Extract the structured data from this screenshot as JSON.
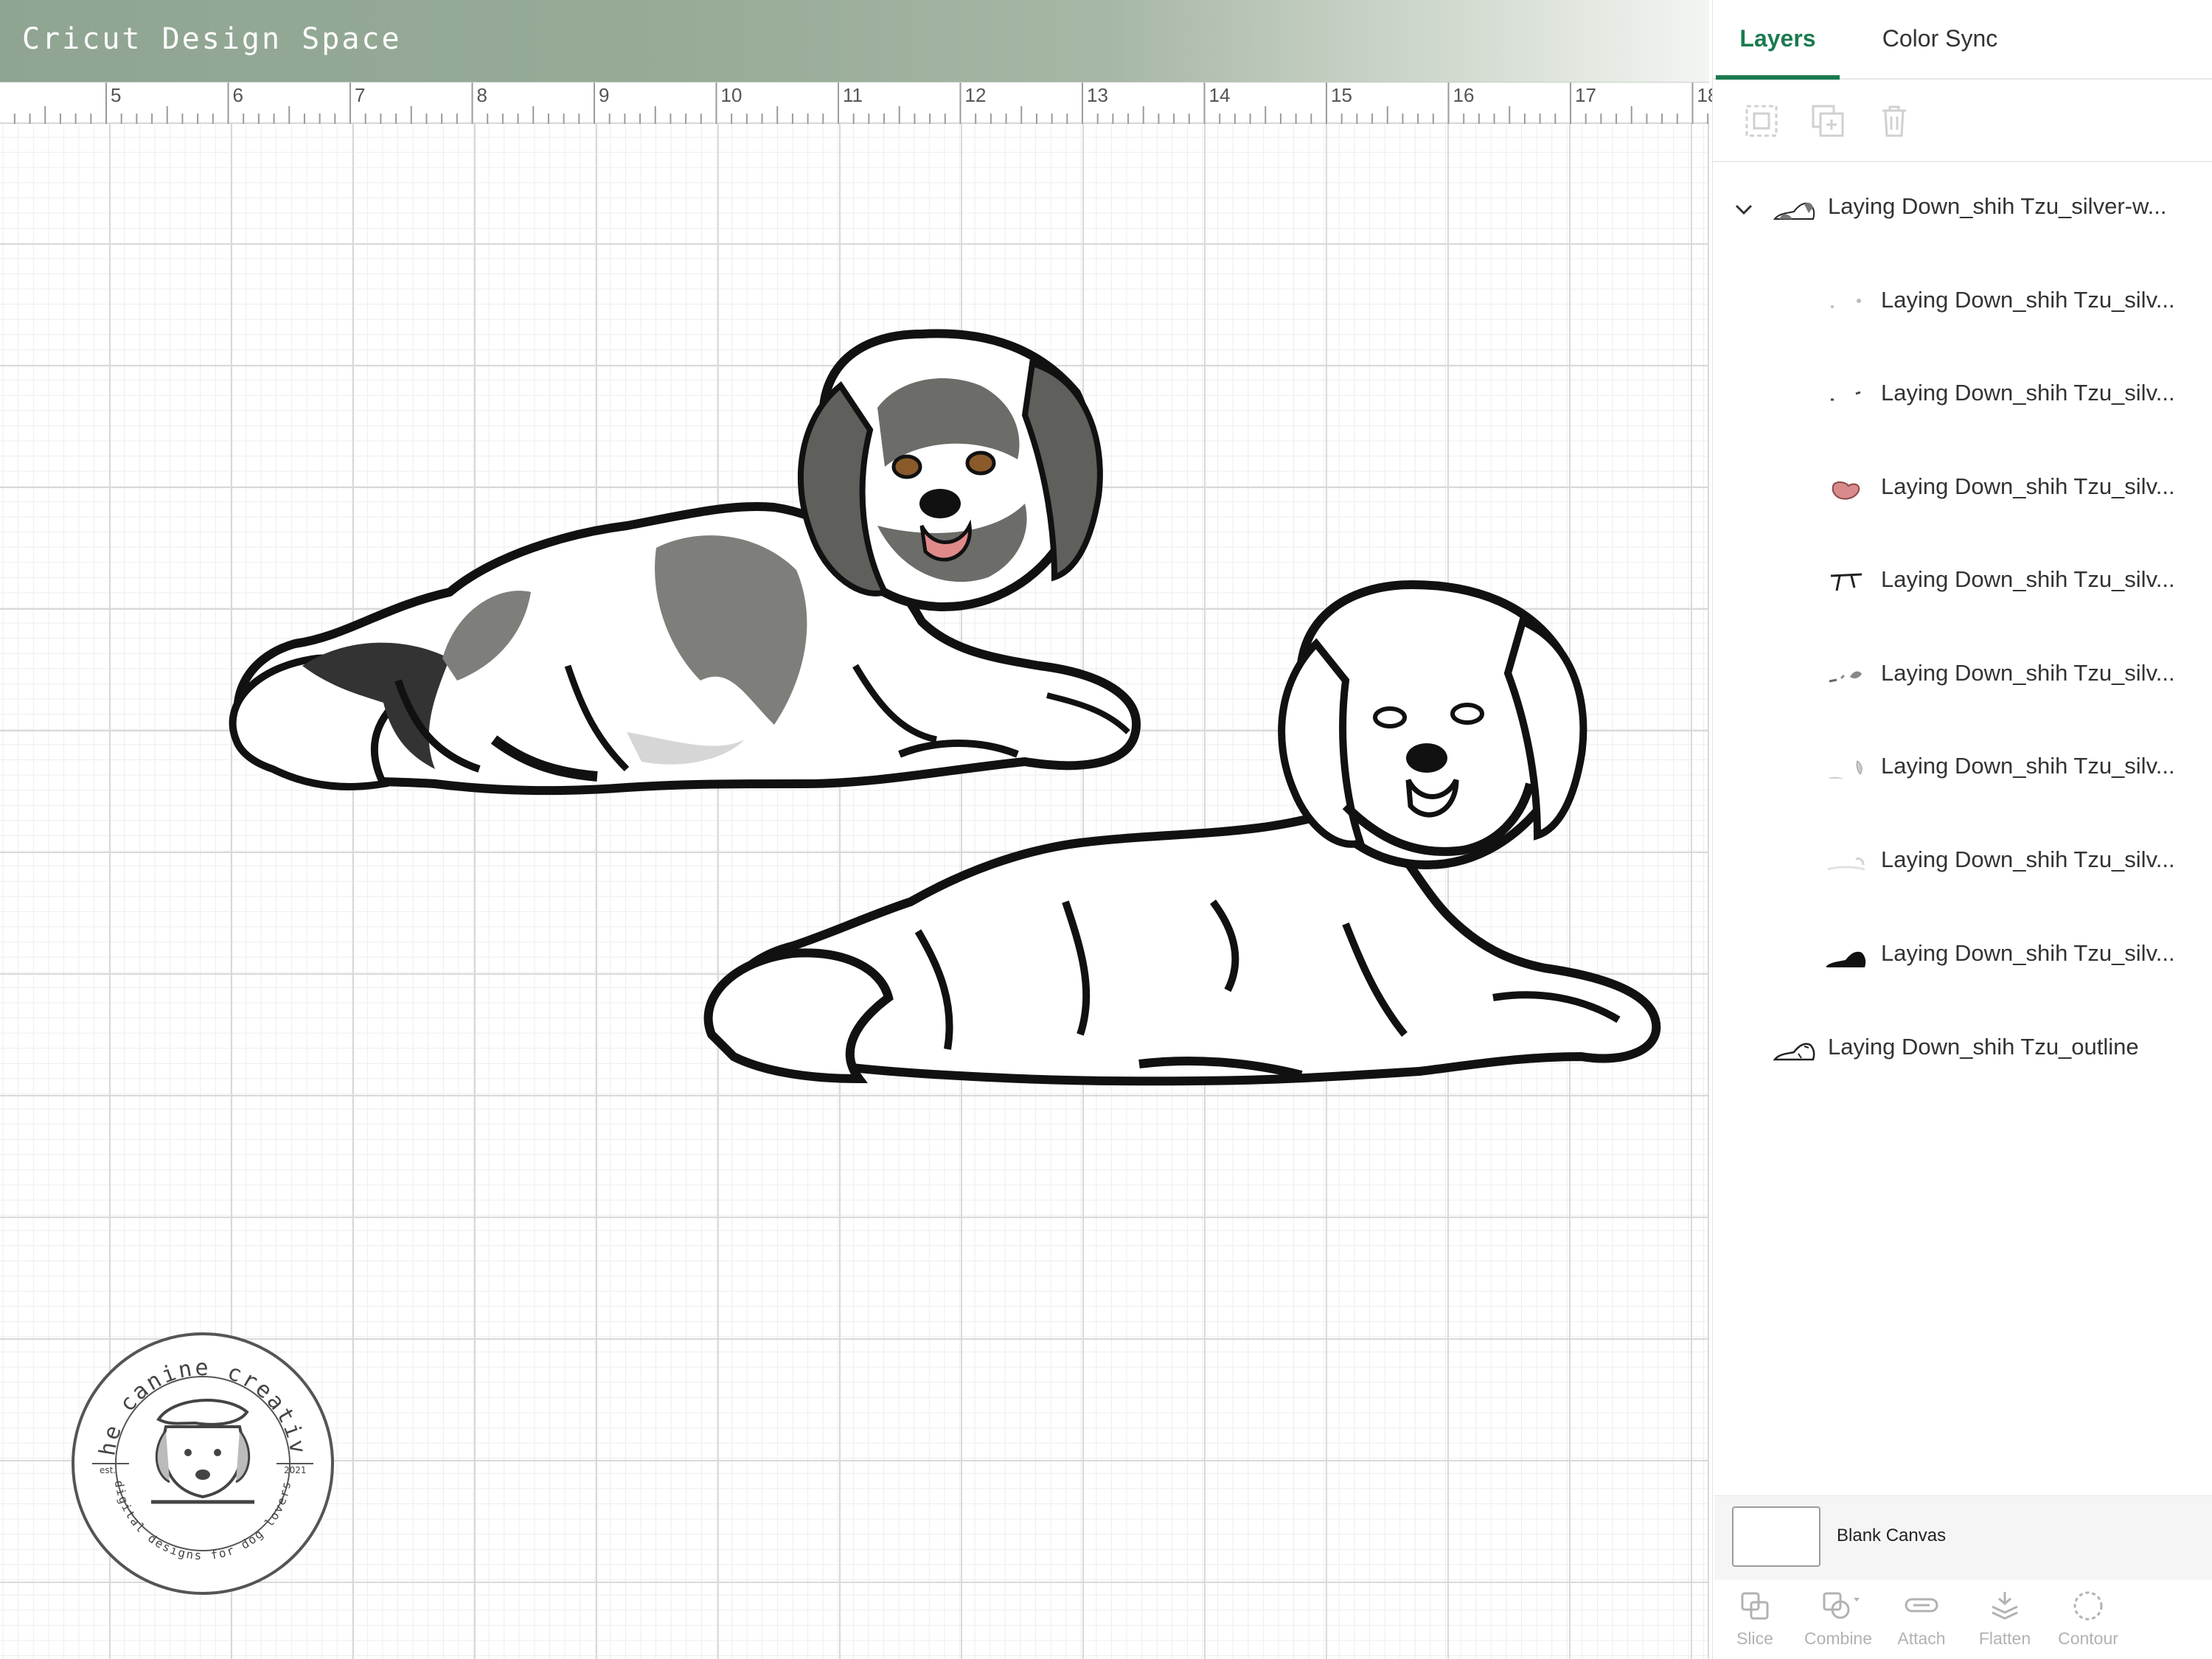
{
  "app": {
    "title": "Cricut Design Space"
  },
  "ruler": {
    "labels": [
      "5",
      "6",
      "7",
      "8",
      "9",
      "10",
      "11",
      "12",
      "13",
      "14",
      "15",
      "16",
      "17",
      "18"
    ]
  },
  "panel": {
    "tabs": [
      {
        "label": "Layers",
        "active": true
      },
      {
        "label": "Color Sync",
        "active": false
      }
    ],
    "toolbar": [
      "group-icon",
      "duplicate-icon",
      "delete-icon"
    ],
    "layers": [
      {
        "label": "Laying Down_shih Tzu_silver-w...",
        "level": 0,
        "expanded": true,
        "thumb": "dog-thumb"
      },
      {
        "label": "Laying Down_shih Tzu_silv...",
        "level": 1,
        "thumb": "speck-thumb"
      },
      {
        "label": "Laying Down_shih Tzu_silv...",
        "level": 1,
        "thumb": "dash-thumb"
      },
      {
        "label": "Laying Down_shih Tzu_silv...",
        "level": 1,
        "thumb": "tongue-thumb",
        "color": "#d98a8a"
      },
      {
        "label": "Laying Down_shih Tzu_silv...",
        "level": 1,
        "thumb": "eyes-thumb"
      },
      {
        "label": "Laying Down_shih Tzu_silv...",
        "level": 1,
        "thumb": "grey-patch-thumb"
      },
      {
        "label": "Laying Down_shih Tzu_silv...",
        "level": 1,
        "thumb": "light-patch-thumb"
      },
      {
        "label": "Laying Down_shih Tzu_silv...",
        "level": 1,
        "thumb": "faint-patch-thumb"
      },
      {
        "label": "Laying Down_shih Tzu_silv...",
        "level": 1,
        "thumb": "black-silhouette-thumb"
      },
      {
        "label": "Laying Down_shih Tzu_outline",
        "level": 0,
        "thumb": "outline-thumb"
      }
    ],
    "canvas": {
      "label": "Blank Canvas"
    },
    "actions": [
      {
        "label": "Slice",
        "icon": "slice-icon"
      },
      {
        "label": "Combine",
        "icon": "combine-icon"
      },
      {
        "label": "Attach",
        "icon": "attach-icon"
      },
      {
        "label": "Flatten",
        "icon": "flatten-icon"
      },
      {
        "label": "Contour",
        "icon": "contour-icon"
      }
    ]
  },
  "watermark": {
    "top_text": "the canine creative",
    "bottom_text": "digital designs for dog lovers",
    "est_label": "est.",
    "year": "2021"
  },
  "colors": {
    "accent": "#1b7a4f",
    "header": "#97ab97",
    "fur_grey": "#7e7f7a",
    "tongue": "#e08a8a"
  }
}
